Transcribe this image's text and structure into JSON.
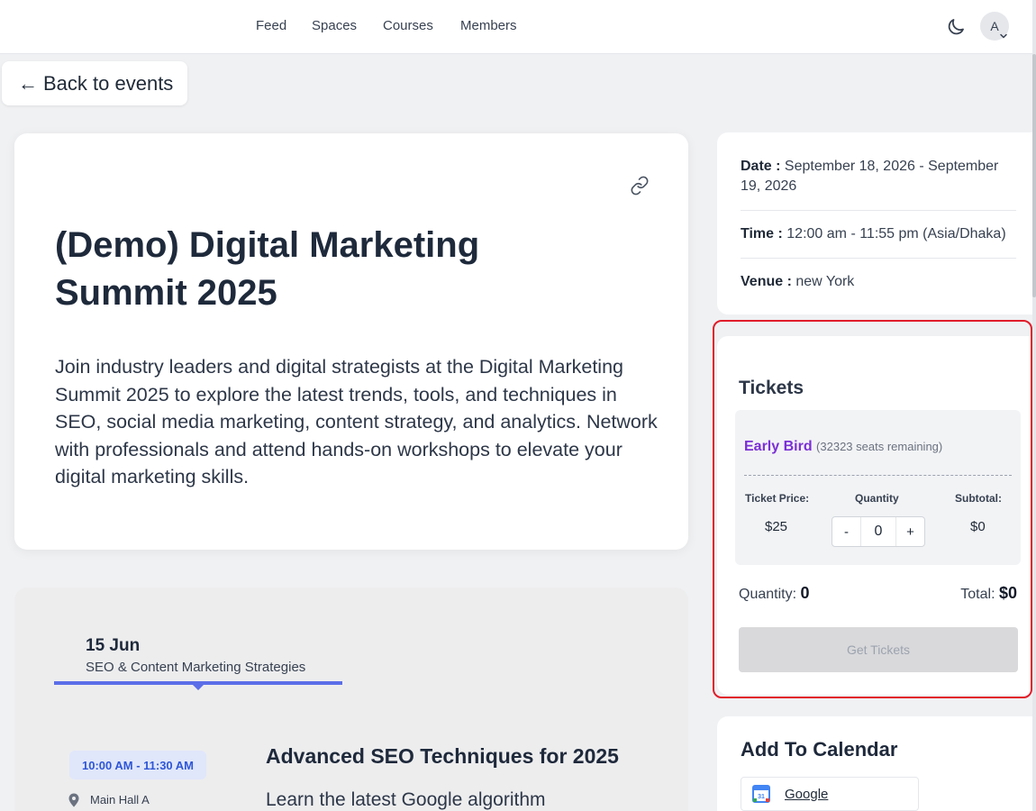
{
  "nav": {
    "links": [
      "Feed",
      "Spaces",
      "Courses",
      "Members"
    ],
    "avatar_initial": "A"
  },
  "back_label": "Back to events",
  "event": {
    "title": "(Demo) Digital Marketing Summit 2025",
    "description": "Join industry leaders and digital strategists at the Digital Marketing Summit 2025 to explore the latest trends, tools, and techniques in SEO, social media marketing, content strategy, and analytics. Network with professionals and attend hands-on workshops to elevate your digital marketing skills."
  },
  "details": {
    "date_label": "Date :",
    "date_value": "September 18, 2026 - September 19, 2026",
    "time_label": "Time :",
    "time_value": "12:00 am - 11:55 pm (Asia/Dhaka)",
    "venue_label": "Venue :",
    "venue_value": "new York"
  },
  "tickets": {
    "heading": "Tickets",
    "ticket_name": "Early Bird",
    "seats_remaining": "(32323 seats remaining)",
    "price_label": "Ticket Price:",
    "price_value": "$25",
    "quantity_label": "Quantity",
    "quantity_value": "0",
    "minus": "-",
    "plus": "+",
    "subtotal_label": "Subtotal:",
    "subtotal_value": "$0",
    "summary_quantity_label": "Quantity:",
    "summary_quantity_value": "0",
    "summary_total_label": "Total:",
    "summary_total_value": "$0",
    "button_label": "Get Tickets"
  },
  "calendar": {
    "heading": "Add To Calendar",
    "google_label": "Google",
    "google_icon_text": "31"
  },
  "agenda": {
    "day_date": "15 Jun",
    "day_topic": "SEO & Content Marketing Strategies",
    "session_time": "10:00 AM - 11:30 AM",
    "session_location": "Main Hall A",
    "session_title": "Advanced SEO Techniques for 2025",
    "session_desc": "Learn the latest Google algorithm"
  },
  "colors": {
    "accent": "#5b6ee8",
    "ticket_name": "#7b2fd6",
    "highlight_outline": "#e11d2a",
    "time_pill_text": "#2f56d6"
  }
}
